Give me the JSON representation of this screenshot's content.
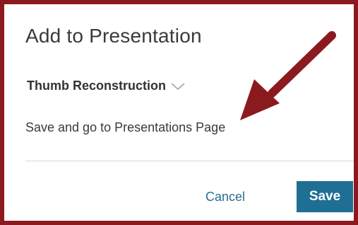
{
  "dialog": {
    "title": "Add to Presentation",
    "selected_presentation": "Thumb Reconstruction",
    "save_and_go_label": "Save and go to Presentations Page",
    "cancel_label": "Cancel",
    "save_label": "Save"
  },
  "icons": {
    "dropdown": "chevron-down-icon",
    "annotation": "arrow-icon"
  },
  "colors": {
    "frame_border": "#8b1a1f",
    "annotation_arrow": "#8b1a1f",
    "save_button_bg": "#1f6f94",
    "cancel_text": "#2a6e8f",
    "divider": "#d8d8d8"
  }
}
